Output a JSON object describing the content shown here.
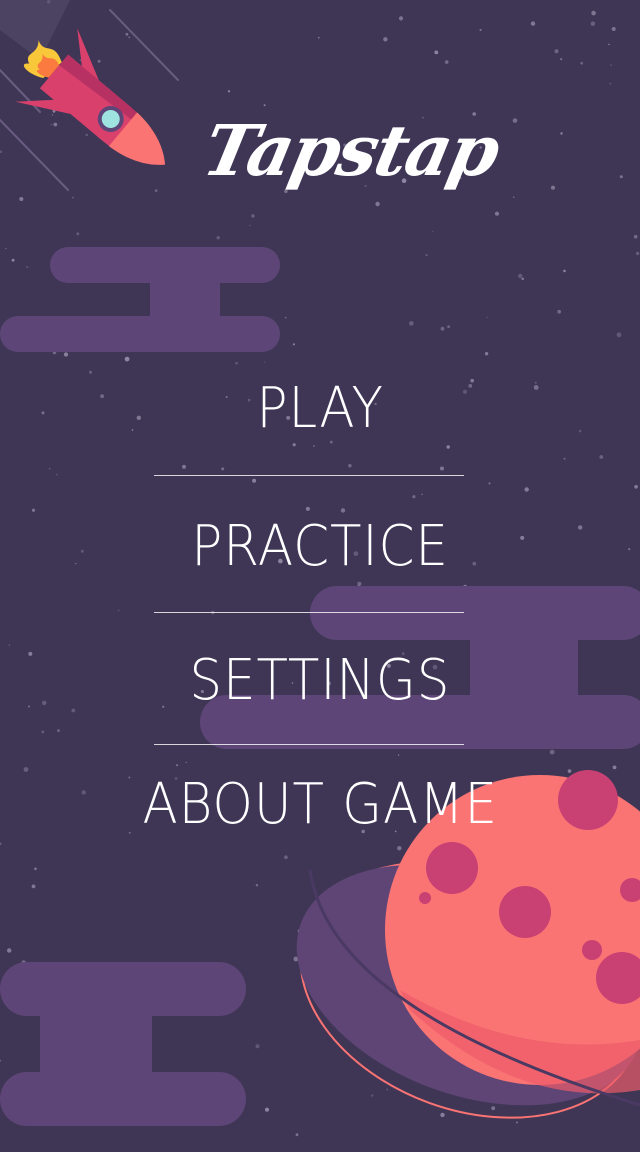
{
  "app": {
    "logo_text": "Tapstap"
  },
  "menu": {
    "play_label": "PLAY",
    "practice_label": "PRACTICE",
    "settings_label": "SETTINGS",
    "about_label": "ABOUT GAME"
  },
  "colors": {
    "background": "#3f3656",
    "cloud": "#5d4677",
    "planet": "#fb7474",
    "planet_shade": "#ec5b6a",
    "crater": "#c94073",
    "ring": "#5f4576",
    "rocket_body": "#d9406c",
    "rocket_nose": "#fb7474",
    "text": "#ffffff"
  },
  "icons": {
    "rocket": "rocket-icon",
    "planet": "planet-icon"
  }
}
